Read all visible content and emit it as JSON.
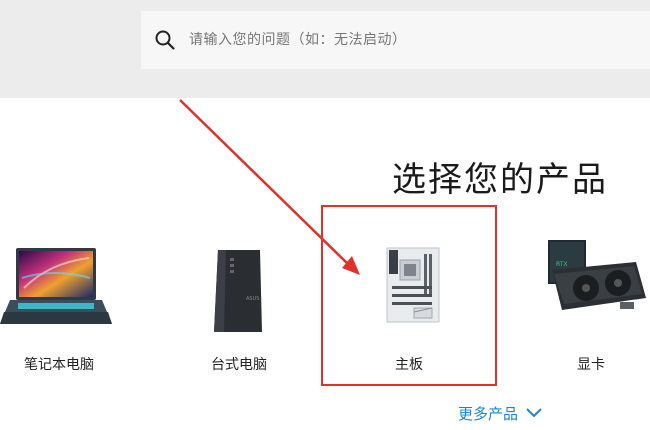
{
  "search": {
    "placeholder": "请输入您的问题（如：无法启动）"
  },
  "section": {
    "title": "选择您的产品"
  },
  "products": [
    {
      "label": "笔记本电脑",
      "icon": "laptop-icon"
    },
    {
      "label": "台式电脑",
      "icon": "desktop-tower-icon"
    },
    {
      "label": "主板",
      "icon": "motherboard-icon"
    },
    {
      "label": "显卡",
      "icon": "graphics-card-icon"
    }
  ],
  "more": {
    "label": "更多产品"
  },
  "colors": {
    "highlight": "#e0312b",
    "link": "#1a87d6",
    "header_bg": "#ececec"
  }
}
